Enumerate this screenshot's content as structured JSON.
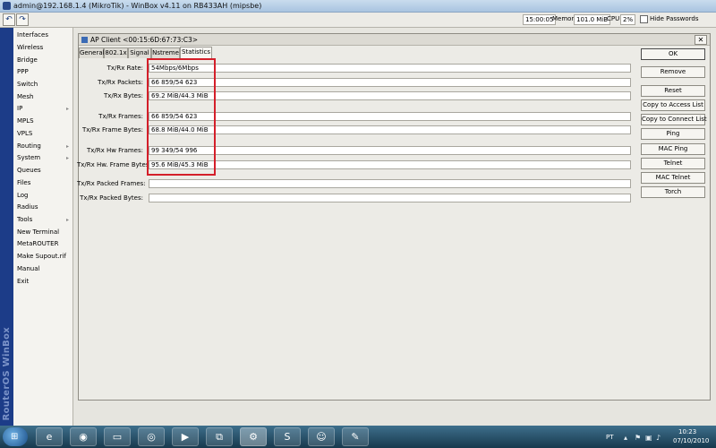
{
  "window": {
    "title": "admin@192.168.1.4 (MikroTik) - WinBox v4.11 on RB433AH (mipsbe)"
  },
  "toolbar": {
    "undo_icon": "undo-icon",
    "redo_icon": "redo-icon",
    "time": "15:00:05",
    "memory_label": "Memory:",
    "memory_value": "101.0 MiB",
    "cpu_label": "CPU:",
    "cpu_value": "2%",
    "hide_passwords_label": "Hide Passwords",
    "hide_passwords_checked": false
  },
  "sidebar": {
    "vertical_text": "RouterOS WinBox",
    "items": [
      {
        "label": "Interfaces",
        "submenu": false
      },
      {
        "label": "Wireless",
        "submenu": false
      },
      {
        "label": "Bridge",
        "submenu": false
      },
      {
        "label": "PPP",
        "submenu": false
      },
      {
        "label": "Switch",
        "submenu": false
      },
      {
        "label": "Mesh",
        "submenu": false
      },
      {
        "label": "IP",
        "submenu": true
      },
      {
        "label": "MPLS",
        "submenu": false
      },
      {
        "label": "VPLS",
        "submenu": false
      },
      {
        "label": "Routing",
        "submenu": true
      },
      {
        "label": "System",
        "submenu": true
      },
      {
        "label": "Queues",
        "submenu": false
      },
      {
        "label": "Files",
        "submenu": false
      },
      {
        "label": "Log",
        "submenu": false
      },
      {
        "label": "Radius",
        "submenu": false
      },
      {
        "label": "Tools",
        "submenu": true
      },
      {
        "label": "New Terminal",
        "submenu": false
      },
      {
        "label": "MetaROUTER",
        "submenu": false
      },
      {
        "label": "Make Supout.rif",
        "submenu": false
      },
      {
        "label": "Manual",
        "submenu": false
      },
      {
        "label": "Exit",
        "submenu": false
      }
    ],
    "submenu_arrow": "▸"
  },
  "dialog": {
    "title": "AP Client <00:15:6D:67:73:C3>",
    "close_glyph": "✕",
    "tabs": [
      "General",
      "802.1x",
      "Signal",
      "Nstreme",
      "Statistics"
    ],
    "active_tab": "Statistics",
    "stats": [
      {
        "label": "Tx/Rx Rate:",
        "value": "54Mbps/6Mbps"
      },
      {
        "label": "Tx/Rx Packets:",
        "value": "66 859/54 623"
      },
      {
        "label": "Tx/Rx Bytes:",
        "value": "69.2 MiB/44.3 MiB"
      },
      {
        "label": "Tx/Rx Frames:",
        "value": "66 859/54 623"
      },
      {
        "label": "Tx/Rx Frame Bytes:",
        "value": "68.8 MiB/44.0 MiB"
      },
      {
        "label": "Tx/Rx Hw Frames:",
        "value": "99 349/54 996"
      },
      {
        "label": "Tx/Rx Hw. Frame Bytes:",
        "value": "95.6 MiB/45.3 MiB"
      },
      {
        "label": "Tx/Rx Packed Frames:",
        "value": ""
      },
      {
        "label": "Tx/Rx Packed Bytes:",
        "value": ""
      }
    ],
    "buttons": [
      "OK",
      "Remove",
      "Reset",
      "Copy to Access List",
      "Copy to Connect List",
      "Ping",
      "MAC Ping",
      "Telnet",
      "MAC Telnet",
      "Torch"
    ],
    "highlight_color": "#d41f2a"
  },
  "taskbar": {
    "start_glyph": "⊞",
    "apps": [
      {
        "icon": "internet-explorer-icon",
        "glyph": "e"
      },
      {
        "icon": "firefox-icon",
        "glyph": "◉"
      },
      {
        "icon": "folder-icon",
        "glyph": "▭"
      },
      {
        "icon": "media-player-icon",
        "glyph": "◎"
      },
      {
        "icon": "player-icon",
        "glyph": "▶"
      },
      {
        "icon": "network-icon",
        "glyph": "⧉"
      },
      {
        "icon": "winbox-icon",
        "glyph": "⚙"
      },
      {
        "icon": "skype-icon",
        "glyph": "S"
      },
      {
        "icon": "chat-icon",
        "glyph": "☺"
      },
      {
        "icon": "paint-icon",
        "glyph": "✎"
      }
    ],
    "language": "PT",
    "clock_time": "10:23",
    "clock_date": "07/10/2010"
  }
}
